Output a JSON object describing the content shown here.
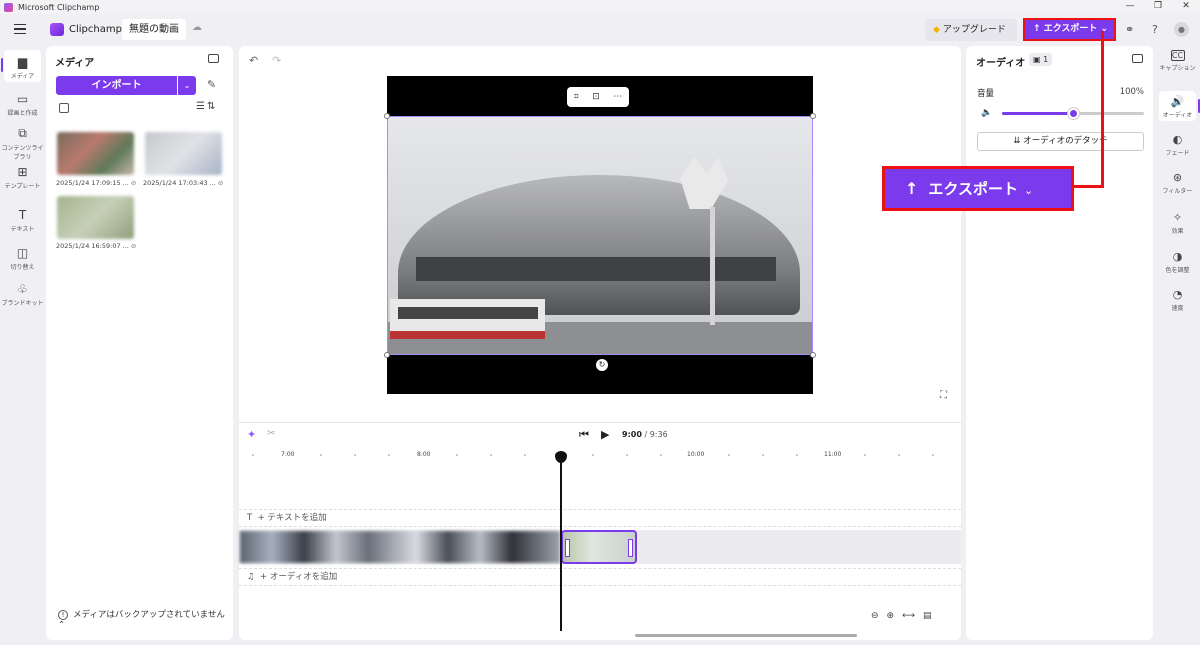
{
  "window": {
    "title": "Microsoft Clipchamp",
    "controls": [
      "—",
      "❐",
      "✕"
    ]
  },
  "topbar": {
    "brand": "Clipchamp",
    "project_name": "無題の動画",
    "upgrade_label": "アップグレード",
    "export_label": "エクスポート",
    "help": "?"
  },
  "left_rail": {
    "items": [
      {
        "label": "メディア",
        "icon": "folder-icon",
        "glyph": "▆",
        "active": true
      },
      {
        "label": "録画と作成",
        "icon": "camera-icon",
        "glyph": "▭"
      },
      {
        "label": "コンテンツライブラリ",
        "icon": "library-icon",
        "glyph": "⧉"
      },
      {
        "label": "テンプレート",
        "icon": "template-icon",
        "glyph": "⊞"
      },
      {
        "label": "テキスト",
        "icon": "text-icon",
        "glyph": "T"
      },
      {
        "label": "切り替え",
        "icon": "transition-icon",
        "glyph": "◫"
      },
      {
        "label": "ブランドキット",
        "icon": "brand-kit-icon",
        "glyph": "♧"
      }
    ]
  },
  "media_panel": {
    "title": "メディア",
    "import_label": "インポート",
    "thumbnails": [
      {
        "caption": "2025/1/24 17:09:15 ..."
      },
      {
        "caption": "2025/1/24 17:03:43 ..."
      },
      {
        "caption": "2025/1/24 16:59:07 ..."
      }
    ],
    "backup_notice": "メディアはバックアップされていません"
  },
  "timeline": {
    "current_time": "9:00",
    "total_time": "/ 9:36",
    "ruler_labels": [
      "7:00",
      "8:00",
      "10:00",
      "11:00"
    ],
    "add_text": "+ テキストを追加",
    "add_audio": "+ オーディオを追加"
  },
  "props_panel": {
    "title": "オーディオ",
    "badge": "1",
    "volume_label": "音量",
    "volume_value": "100%",
    "volume_level": 0.5,
    "detach_label": "オーディオのデタッチ"
  },
  "right_rail": {
    "items": [
      {
        "label": "キャプション",
        "icon": "caption-icon",
        "glyph": "CC"
      },
      {
        "label": "オーディオ",
        "icon": "speaker-icon",
        "glyph": "🔊",
        "active": true
      },
      {
        "label": "フェード",
        "icon": "fade-icon",
        "glyph": "◐"
      },
      {
        "label": "フィルター",
        "icon": "filter-icon",
        "glyph": "⊛"
      },
      {
        "label": "効果",
        "icon": "effects-icon",
        "glyph": "✧"
      },
      {
        "label": "色を調整",
        "icon": "color-icon",
        "glyph": "◑"
      },
      {
        "label": "速度",
        "icon": "speed-icon",
        "glyph": "◔"
      }
    ]
  },
  "callout": {
    "label": "エクスポート",
    "highlight_color": "#e11111"
  },
  "colors": {
    "accent": "#7c3aed",
    "background": "#f0f0f4"
  }
}
